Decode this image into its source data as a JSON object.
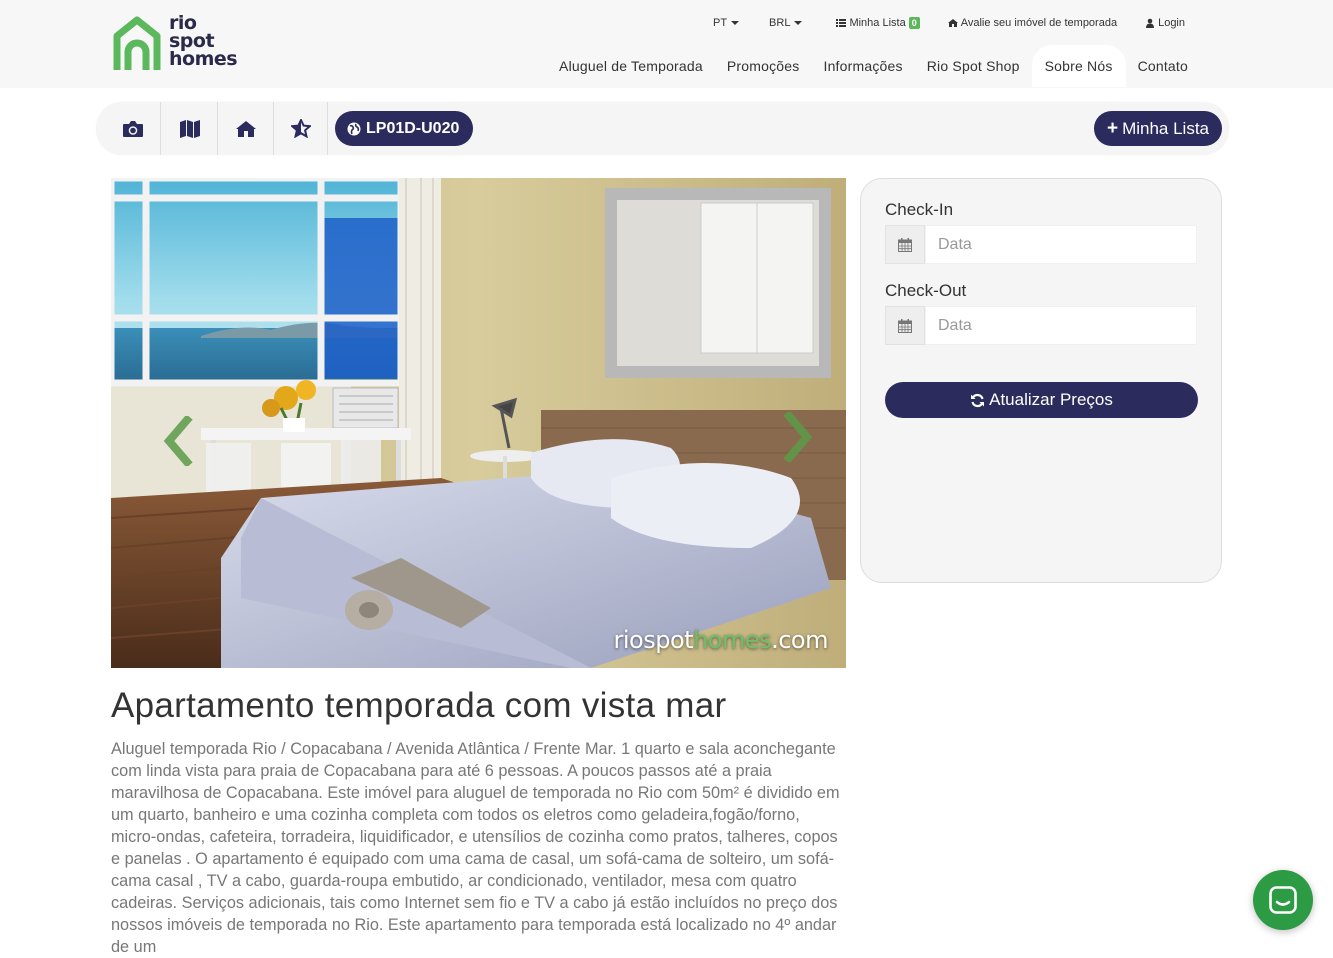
{
  "brand": {
    "logo_line1": "rio",
    "logo_line2": "spot",
    "logo_line3": "homes",
    "green": "#5cb85c",
    "navy": "#2b2b5e"
  },
  "topbar": {
    "language": "PT",
    "currency": "BRL",
    "my_list_label": "Minha Lista",
    "my_list_count": "0",
    "evaluate_label": "Avalie seu imóvel de temporada",
    "login_label": "Login"
  },
  "nav": {
    "items": [
      {
        "label": "Aluguel de Temporada"
      },
      {
        "label": "Promoções"
      },
      {
        "label": "Informações"
      },
      {
        "label": "Rio Spot Shop"
      },
      {
        "label": "Sobre Nós"
      },
      {
        "label": "Contato"
      }
    ]
  },
  "toolbar": {
    "icons": [
      "camera-icon",
      "map-icon",
      "home-icon",
      "star-half-icon"
    ],
    "property_code": "LP01D-U020",
    "add_list_label": "Minha Lista"
  },
  "photo": {
    "watermark_prefix": "riospot",
    "watermark_highlight": "homes",
    "watermark_suffix": ".com"
  },
  "listing": {
    "title": "Apartamento temporada com vista mar",
    "description": "Aluguel temporada Rio / Copacabana / Avenida Atlântica / Frente Mar. 1 quarto e sala aconchegante com linda vista para praia de Copacabana para até 6 pessoas. A poucos passos até a praia maravilhosa de Copacabana. Este imóvel para aluguel de temporada no Rio com 50m² é dividido em um quarto, banheiro e uma cozinha completa com todos os eletros como geladeira,fogão/forno, micro-ondas, cafeteira, torradeira, liquidificador, e utensílios de cozinha como pratos, talheres, copos e panelas . O apartamento é equipado com uma cama de casal, um sofá-cama de solteiro, um sofá-cama casal , TV a cabo, guarda-roupa embutido, ar condicionado, ventilador, mesa com quatro cadeiras. Serviços adicionais, tais como Internet sem fio e TV a cabo já estão incluídos no preço dos nossos imóveis de temporada no Rio. Este apartamento para temporada está localizado no 4º andar de um"
  },
  "booking": {
    "checkin_label": "Check-In",
    "checkin_placeholder": "Data",
    "checkout_label": "Check-Out",
    "checkout_placeholder": "Data",
    "update_button": "Atualizar Preços"
  }
}
